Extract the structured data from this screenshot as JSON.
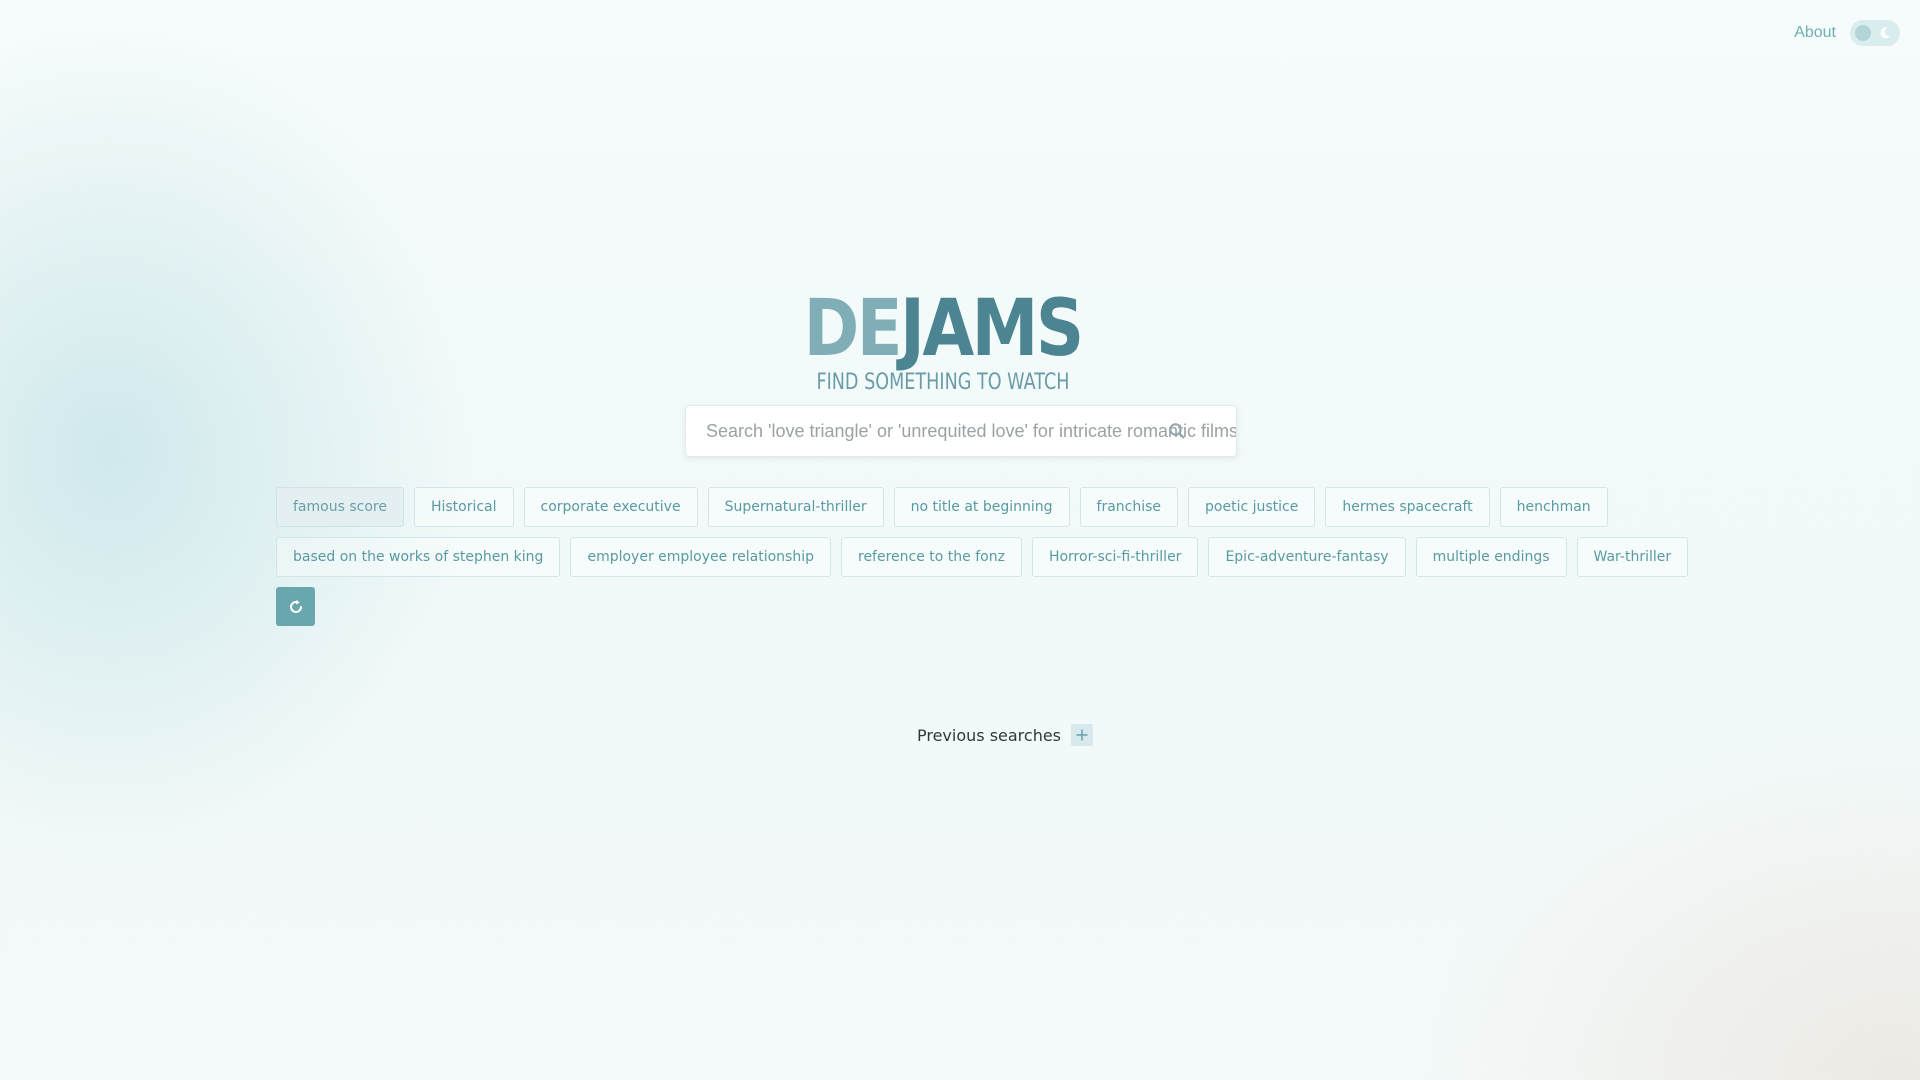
{
  "nav": {
    "about_label": "About",
    "theme_toggle_icon": "moon-icon"
  },
  "logo": {
    "part1": "DE",
    "part2": "JAMS",
    "tagline": "FIND SOMETHING TO WATCH"
  },
  "search": {
    "placeholder": "Search 'love triangle' or 'unrequited love' for intricate romantic films",
    "value": "",
    "icon": "search-icon"
  },
  "tags": {
    "row1": [
      "famous score",
      "Historical",
      "corporate executive",
      "Supernatural-thriller",
      "no title at beginning",
      "franchise",
      "poetic justice",
      "hermes spacecraft",
      "henchman"
    ],
    "row2": [
      "based on the works of stephen king",
      "employer employee relationship",
      "reference to the fonz",
      "Horror-sci-fi-thriller",
      "Epic-adventure-fantasy",
      "multiple endings",
      "War-thriller"
    ],
    "refresh_icon": "refresh-icon"
  },
  "previous": {
    "label": "Previous searches",
    "add_icon": "plus-icon"
  },
  "colors": {
    "accent": "#6aa6ae",
    "logo_light": "#7faeb7",
    "logo_dark": "#4c8591",
    "tag_text": "#5a9aa2"
  }
}
